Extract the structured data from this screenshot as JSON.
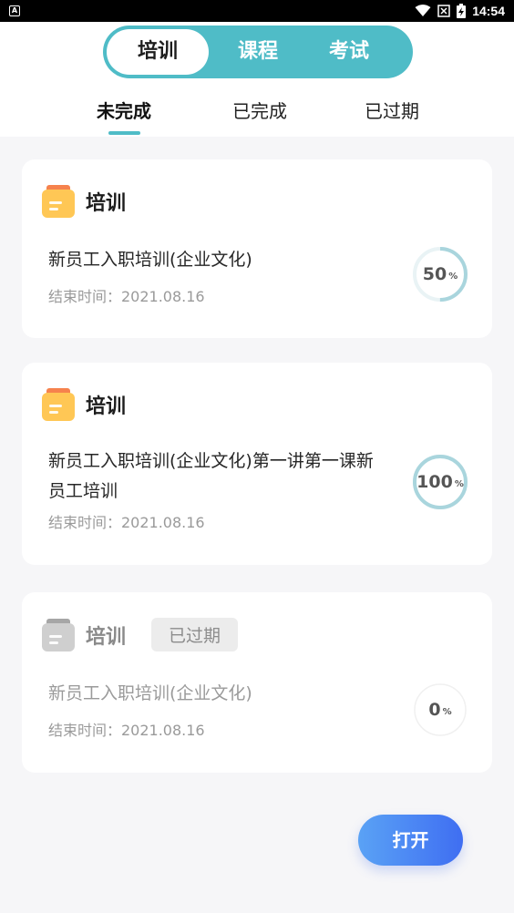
{
  "status_bar": {
    "app_indicator": "A",
    "time": "14:54"
  },
  "segmented_tabs": [
    {
      "label": "培训",
      "active": true
    },
    {
      "label": "课程",
      "active": false
    },
    {
      "label": "考试",
      "active": false
    }
  ],
  "sub_tabs": [
    {
      "label": "未完成",
      "active": true
    },
    {
      "label": "已完成",
      "active": false
    },
    {
      "label": "已过期",
      "active": false
    }
  ],
  "cards": [
    {
      "type": "培训",
      "title": "新员工入职培训(企业文化)",
      "end_time": "结束时间：2021.08.16",
      "progress_value": "50",
      "progress_unit": "%",
      "progress_fraction": 0.5,
      "expired": false
    },
    {
      "type": "培训",
      "title": "新员工入职培训(企业文化)第一讲第一课新员工培训",
      "end_time": "结束时间：2021.08.16",
      "progress_value": "100",
      "progress_unit": "%",
      "progress_fraction": 1.0,
      "expired": false
    },
    {
      "type": "培训",
      "badge": "已过期",
      "title": "新员工入职培训(企业文化)",
      "end_time": "结束时间：2021.08.16",
      "progress_value": "0",
      "progress_unit": "%",
      "progress_fraction": 0.0,
      "expired": true
    }
  ],
  "open_button": {
    "label": "打开"
  },
  "colors": {
    "accent": "#4fbcc7",
    "ring_progress": "#a9d5dd",
    "ring_track": "#e9f3f5",
    "button_start": "#5aa2f5",
    "button_end": "#3f6ef2"
  }
}
